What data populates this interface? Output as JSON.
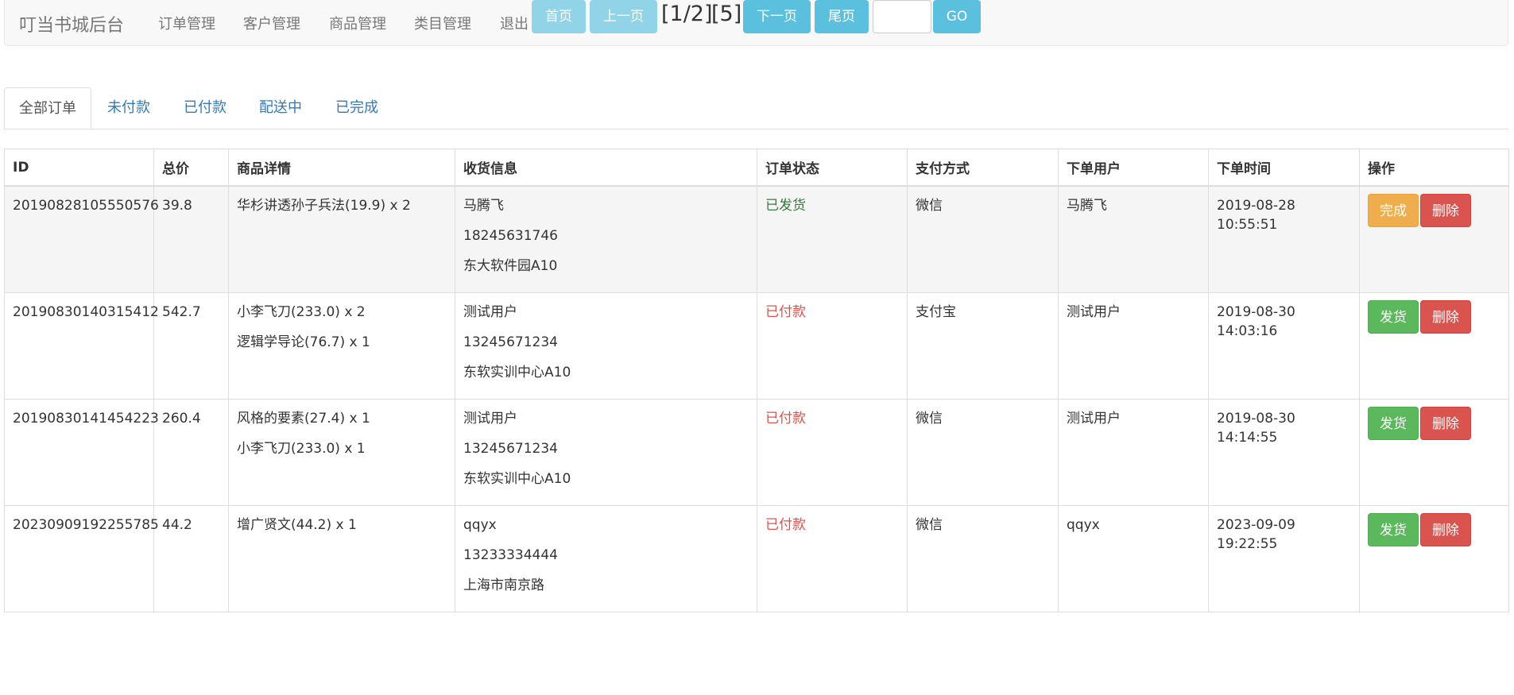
{
  "navbar": {
    "brand": "叮当书城后台",
    "links": [
      "订单管理",
      "客户管理",
      "商品管理",
      "类目管理",
      "退出"
    ]
  },
  "tabs": [
    "全部订单",
    "未付款",
    "已付款",
    "配送中",
    "已完成"
  ],
  "table": {
    "headers": [
      "ID",
      "总价",
      "商品详情",
      "收货信息",
      "订单状态",
      "支付方式",
      "下单用户",
      "下单时间",
      "操作"
    ],
    "rows": [
      {
        "id": "20190828105550576",
        "total": "39.8",
        "items": [
          "华杉讲透孙子兵法(19.9) x 2"
        ],
        "shipping": [
          "马腾飞",
          "18245631746",
          "东大软件园A10"
        ],
        "status": "已发货",
        "pay": "微信",
        "user": "马腾飞",
        "time": "2019-08-28 10:55:51",
        "action": "完成",
        "delete": "删除"
      },
      {
        "id": "20190830140315412",
        "total": "542.7",
        "items": [
          "小李飞刀(233.0) x 2",
          "逻辑学导论(76.7) x 1"
        ],
        "shipping": [
          "测试用户",
          "13245671234",
          "东软实训中心A10"
        ],
        "status": "已付款",
        "pay": "支付宝",
        "user": "测试用户",
        "time": "2019-08-30 14:03:16",
        "action": "发货",
        "delete": "删除"
      },
      {
        "id": "20190830141454223",
        "total": "260.4",
        "items": [
          "风格的要素(27.4) x 1",
          "小李飞刀(233.0) x 1"
        ],
        "shipping": [
          "测试用户",
          "13245671234",
          "东软实训中心A10"
        ],
        "status": "已付款",
        "pay": "微信",
        "user": "测试用户",
        "time": "2019-08-30 14:14:55",
        "action": "发货",
        "delete": "删除"
      },
      {
        "id": "20230909192255785",
        "total": "44.2",
        "items": [
          "增广贤文(44.2) x 1"
        ],
        "shipping": [
          "qqyx",
          "13233334444",
          "上海市南京路"
        ],
        "status": "已付款",
        "pay": "微信",
        "user": "qqyx",
        "time": "2023-09-09 19:22:55",
        "action": "发货",
        "delete": "删除"
      }
    ]
  },
  "pager": {
    "first": "首页",
    "prev": "上一页",
    "page_info": "[1/2]",
    "total": "[5]",
    "next": "下一页",
    "last": "尾页",
    "go": "GO",
    "input_value": ""
  },
  "colors": {
    "link": "#337ab7",
    "warning": "#f0ad4e",
    "danger": "#d9534f",
    "success": "#5cb85c",
    "info": "#5bc0de",
    "status_shipped": "#3c763d",
    "status_paid": "#d9534f"
  }
}
